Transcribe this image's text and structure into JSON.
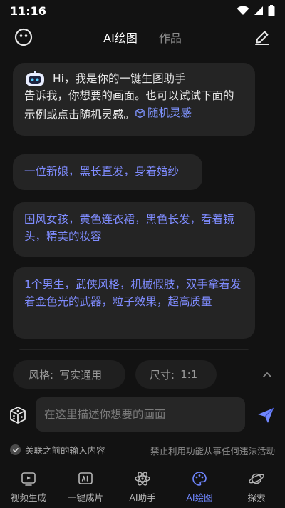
{
  "status": {
    "time": "11:16"
  },
  "header": {
    "tabs": [
      {
        "label": "AI绘图",
        "active": true
      },
      {
        "label": "作品",
        "active": false
      }
    ],
    "left_icon": "smiley-icon",
    "right_icon": "edit-icon"
  },
  "chat": {
    "greeting_title": "Hi，我是你的一键生图助手",
    "greeting_body": "告诉我，你想要的画面。也可以试试下面的示例或点击随机灵感。",
    "inspiration_label": "随机灵感",
    "suggestions": [
      "一位新娘，黑长直发，身着婚纱",
      "国风女孩，黄色连衣裙，黑色长发，看着镜头，精美的妆容",
      "1个男生，武侠风格，机械假肢，双手拿着发着金色光的武器，粒子效果，超高质量"
    ]
  },
  "settings": {
    "style_key": "风格:",
    "style_value": "写实通用",
    "size_key": "尺寸:",
    "size_value": "1:1"
  },
  "composer": {
    "placeholder": "在这里描述你想要的画面",
    "value": ""
  },
  "options": {
    "link_previous_label": "关联之前的输入内容",
    "notice": "禁止利用功能从事任何违法活动"
  },
  "nav": {
    "items": [
      {
        "label": "视频生成",
        "icon": "video-icon",
        "active": false
      },
      {
        "label": "一键成片",
        "icon": "ai-clip-icon",
        "active": false
      },
      {
        "label": "AI助手",
        "icon": "atom-icon",
        "active": false
      },
      {
        "label": "AI绘图",
        "icon": "palette-icon",
        "active": true
      },
      {
        "label": "探索",
        "icon": "planet-icon",
        "active": false
      }
    ]
  },
  "colors": {
    "accent": "#7f8cff",
    "background": "#121212",
    "bubble": "#242424"
  }
}
